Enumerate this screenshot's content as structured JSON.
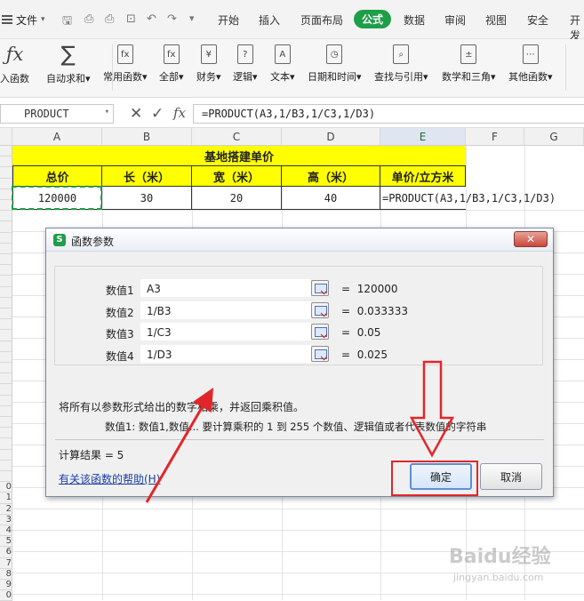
{
  "menubar": {
    "file_label": "文件",
    "tabs": [
      "开始",
      "插入",
      "页面布局",
      "公式",
      "数据",
      "审阅",
      "视图",
      "安全",
      "开发"
    ],
    "active_tab": "公式"
  },
  "ribbon": {
    "items": [
      {
        "icon": "fx-icon",
        "label": "入函数"
      },
      {
        "icon": "sigma-icon",
        "label": "自动求和"
      },
      {
        "icon": "common-func-icon",
        "label": "常用函数"
      },
      {
        "icon": "all-func-icon",
        "label": "全部"
      },
      {
        "icon": "finance-icon",
        "label": "财务"
      },
      {
        "icon": "logic-icon",
        "label": "逻辑"
      },
      {
        "icon": "text-icon",
        "label": "文本"
      },
      {
        "icon": "datetime-icon",
        "label": "日期和时间"
      },
      {
        "icon": "lookup-icon",
        "label": "查找与引用"
      },
      {
        "icon": "math-icon",
        "label": "数学和三角"
      },
      {
        "icon": "other-func-icon",
        "label": "其他函数"
      }
    ]
  },
  "formula_bar": {
    "name_box": "PRODUCT",
    "fx_symbol": "fx",
    "formula": "=PRODUCT(A3,1/B3,1/C3,1/D3)"
  },
  "sheet": {
    "columns": [
      "A",
      "B",
      "C",
      "D",
      "E",
      "F",
      "G"
    ],
    "selected_column": "E",
    "title": "基地搭建单价",
    "headers": [
      "总价",
      "长（米）",
      "宽（米）",
      "高（米）",
      "单价/立方米"
    ],
    "values": [
      "120000",
      "30",
      "20",
      "40"
    ],
    "formula_cell": "=PRODUCT(A3,1/B3,1/C3,1/D3)",
    "row_numbers": [
      "",
      "",
      "",
      "",
      "",
      "",
      "",
      "",
      "",
      "",
      "",
      "",
      "",
      "",
      "",
      "",
      "",
      "",
      "",
      "",
      "",
      "",
      "",
      "",
      "",
      "",
      "",
      "",
      "",
      "",
      "",
      "0",
      "1",
      "2",
      "3",
      "4",
      "5",
      "6",
      "7",
      "8",
      "9",
      "0"
    ]
  },
  "dialog": {
    "logo": "S",
    "title": "函数参数",
    "close": "✕",
    "args": [
      {
        "label": "数值1",
        "value": "A3",
        "result": "120000"
      },
      {
        "label": "数值2",
        "value": "1/B3",
        "result": "0.033333"
      },
      {
        "label": "数值3",
        "value": "1/C3",
        "result": "0.05"
      },
      {
        "label": "数值4",
        "value": "1/D3",
        "result": "0.025"
      }
    ],
    "equals": "=",
    "description": "将所有以参数形式给出的数字相乘，并返回乘积值。",
    "arg_description": "数值1:  数值1,数值... 要计算乘积的 1 到 255 个数值、逻辑值或者代表数值的字符串",
    "result_label": "计算结果 =  5",
    "help_link": "有关该函数的帮助(H)",
    "ok_button": "确定",
    "cancel_button": "取消"
  },
  "watermark": {
    "text": "Baidu经验",
    "sub": "jingyan.baidu.com"
  },
  "colors": {
    "accent_green": "#1e9e48",
    "highlight_yellow": "#ffff00",
    "annotation_red": "#e1262a"
  }
}
